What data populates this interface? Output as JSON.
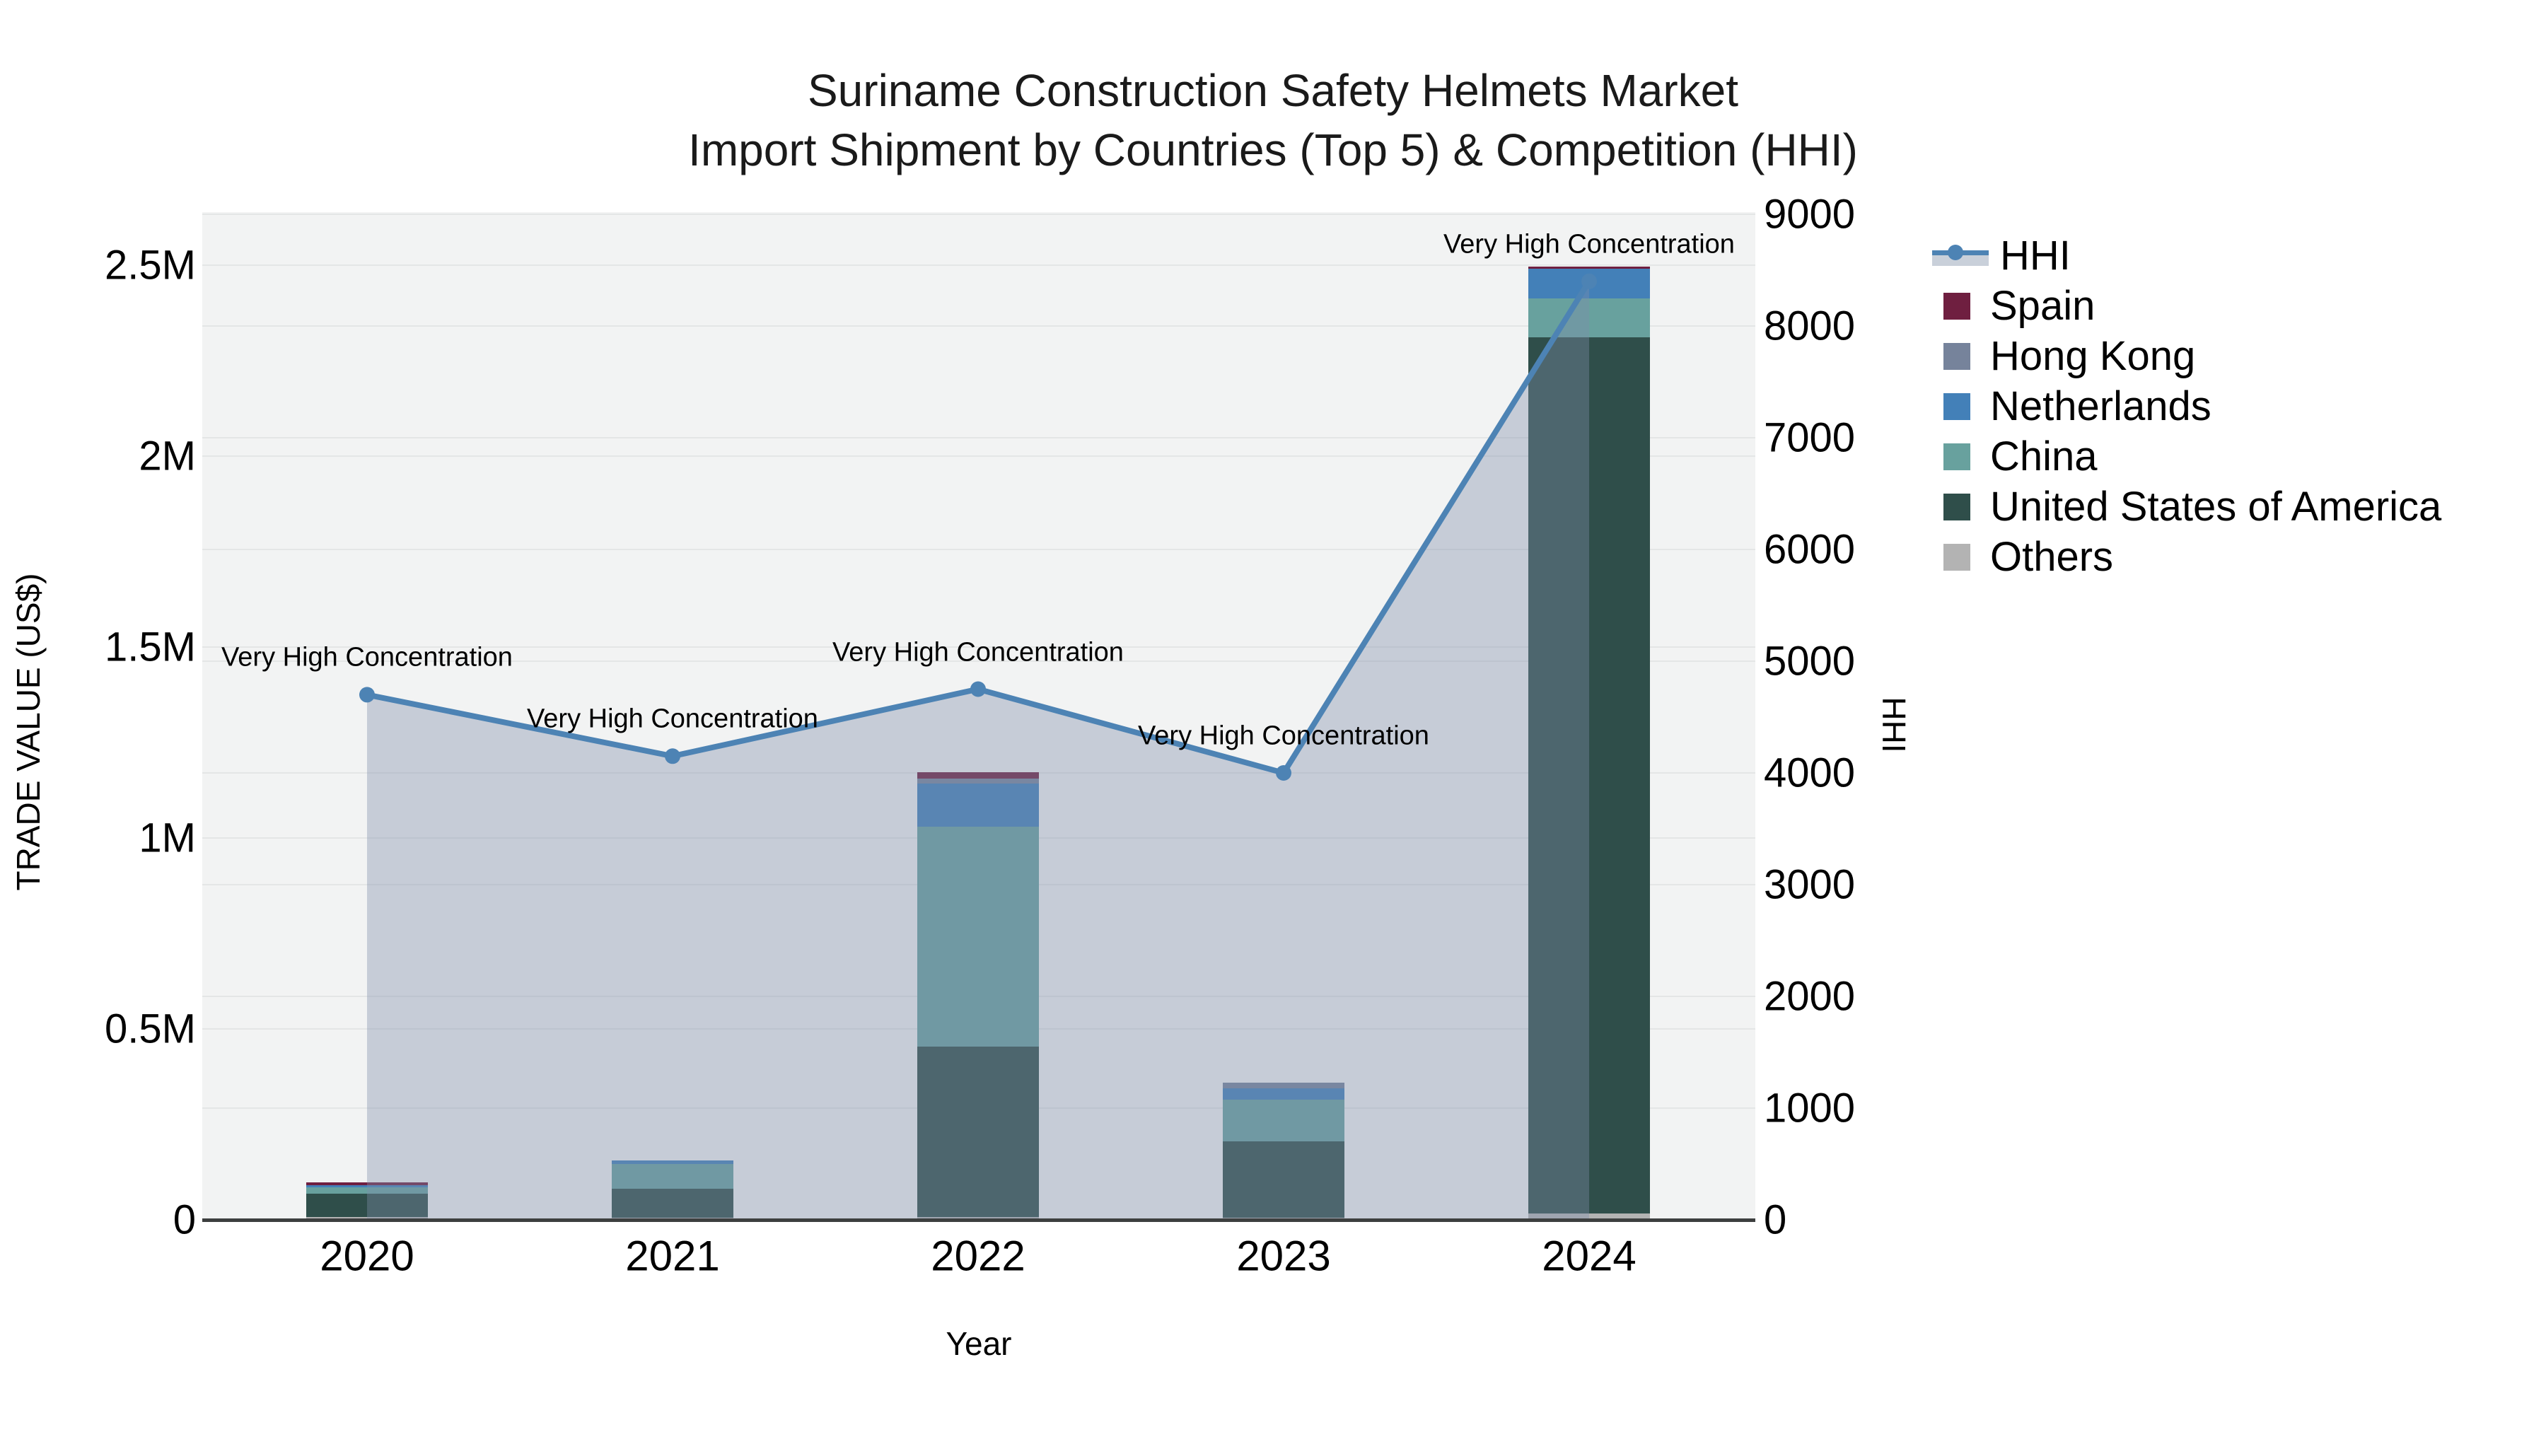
{
  "chart_data": {
    "type": "bar+line",
    "title": "Suriname Construction Safety Helmets Market",
    "subtitle": "Import Shipment by Countries (Top 5) & Competition (HHI)",
    "x": [
      "2020",
      "2021",
      "2022",
      "2023",
      "2024"
    ],
    "x_axis": {
      "title": "Year"
    },
    "left_axis": {
      "title": "TRADE VALUE (US$)",
      "range": [
        0,
        2640000
      ],
      "ticks": [
        {
          "value": 0,
          "label": "0"
        },
        {
          "value": 500000,
          "label": "0.5M"
        },
        {
          "value": 1000000,
          "label": "1M"
        },
        {
          "value": 1500000,
          "label": "1.5M"
        },
        {
          "value": 2000000,
          "label": "2M"
        },
        {
          "value": 2500000,
          "label": "2.5M"
        }
      ]
    },
    "right_axis": {
      "title": "HHI",
      "range": [
        0,
        9000
      ],
      "ticks": [
        {
          "value": 0,
          "label": "0"
        },
        {
          "value": 1000,
          "label": "1000"
        },
        {
          "value": 2000,
          "label": "2000"
        },
        {
          "value": 3000,
          "label": "3000"
        },
        {
          "value": 4000,
          "label": "4000"
        },
        {
          "value": 5000,
          "label": "5000"
        },
        {
          "value": 6000,
          "label": "6000"
        },
        {
          "value": 7000,
          "label": "7000"
        },
        {
          "value": 8000,
          "label": "8000"
        },
        {
          "value": 9000,
          "label": "9000"
        }
      ]
    },
    "bar_series_stack_bottom_to_top": [
      {
        "name": "Others",
        "color": "#b3b3b3",
        "values": [
          8000,
          6000,
          7000,
          5000,
          17000
        ]
      },
      {
        "name": "United States of America",
        "color": "#2f4e4a",
        "values": [
          60000,
          75000,
          446000,
          200000,
          2294000
        ]
      },
      {
        "name": "China",
        "color": "#68a19e",
        "values": [
          17000,
          65000,
          576000,
          110000,
          102000
        ]
      },
      {
        "name": "Netherlands",
        "color": "#4380b8",
        "values": [
          5000,
          9000,
          114000,
          30000,
          78000
        ]
      },
      {
        "name": "Hong Kong",
        "color": "#76839b",
        "values": [
          0,
          0,
          13000,
          15000,
          0
        ]
      },
      {
        "name": "Spain",
        "color": "#6f1f40",
        "values": [
          8000,
          0,
          17000,
          0,
          6000
        ]
      }
    ],
    "line_series": {
      "name": "HHI",
      "color": "#4d83b4",
      "fill_color": "rgba(125,142,170,0.38)",
      "values": [
        4700,
        4150,
        4750,
        4000,
        8400
      ]
    },
    "annotations": [
      {
        "x": "2020",
        "text": "Very High Concentration"
      },
      {
        "x": "2021",
        "text": "Very High Concentration"
      },
      {
        "x": "2022",
        "text": "Very High Concentration"
      },
      {
        "x": "2023",
        "text": "Very High Concentration"
      },
      {
        "x": "2024",
        "text": "Very High Concentration"
      }
    ],
    "legend": [
      {
        "label": "HHI",
        "type": "line",
        "color": "#4d83b4",
        "band_color": "#c9d0da"
      },
      {
        "label": "Spain",
        "type": "swatch",
        "color": "#6f1f40"
      },
      {
        "label": "Hong Kong",
        "type": "swatch",
        "color": "#76839b"
      },
      {
        "label": "Netherlands",
        "type": "swatch",
        "color": "#4380b8"
      },
      {
        "label": "China",
        "type": "swatch",
        "color": "#68a19e"
      },
      {
        "label": "United States of America",
        "type": "swatch",
        "color": "#2f4e4a"
      },
      {
        "label": "Others",
        "type": "swatch",
        "color": "#b3b3b3"
      }
    ],
    "style": {
      "plot_bg": "#f2f3f3",
      "gridline_color": "#e4e6e6",
      "axis_line_color": "#3d3f3f"
    },
    "legend_position": "right",
    "grid": true
  }
}
